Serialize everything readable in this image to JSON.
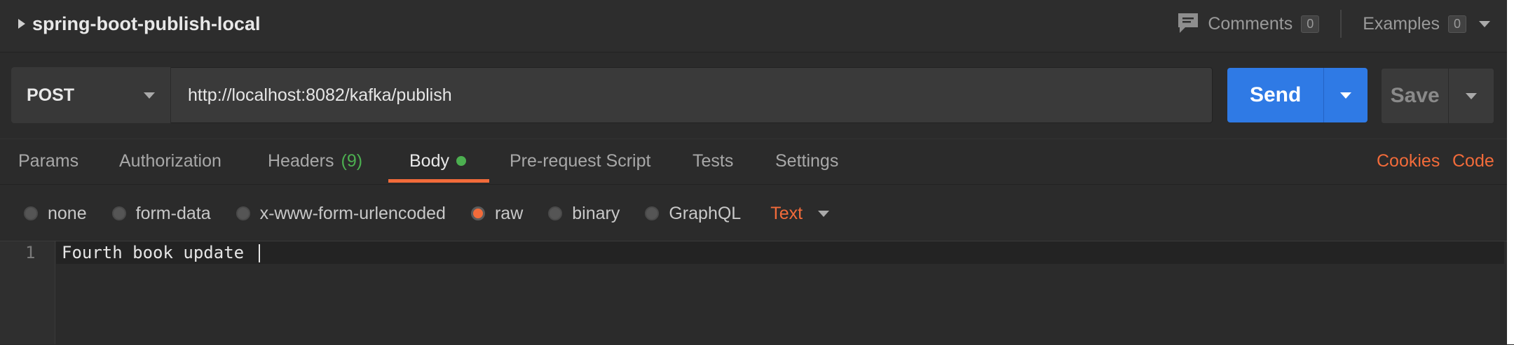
{
  "request": {
    "title": "spring-boot-publish-local"
  },
  "topbar": {
    "comments_label": "Comments",
    "comments_count": "0",
    "examples_label": "Examples",
    "examples_count": "0"
  },
  "url_bar": {
    "method": "POST",
    "url": "http://localhost:8082/kafka/publish",
    "send_label": "Send",
    "save_label": "Save"
  },
  "tabs": [
    {
      "label": "Params"
    },
    {
      "label": "Authorization"
    },
    {
      "label": "Headers",
      "count": "(9)"
    },
    {
      "label": "Body",
      "active": true
    },
    {
      "label": "Pre-request Script"
    },
    {
      "label": "Tests"
    },
    {
      "label": "Settings"
    }
  ],
  "right_links": {
    "cookies": "Cookies",
    "code": "Code"
  },
  "body_types": [
    {
      "label": "none",
      "selected": false
    },
    {
      "label": "form-data",
      "selected": false
    },
    {
      "label": "x-www-form-urlencoded",
      "selected": false
    },
    {
      "label": "raw",
      "selected": true
    },
    {
      "label": "binary",
      "selected": false
    },
    {
      "label": "GraphQL",
      "selected": false
    }
  ],
  "raw_language": "Text",
  "editor": {
    "line_number": "1",
    "line_text": "Fourth book update "
  },
  "colors": {
    "accent": "#f26b3a",
    "send": "#2f7ae5",
    "status_green": "#4caf50",
    "background": "#2b2b2b"
  }
}
